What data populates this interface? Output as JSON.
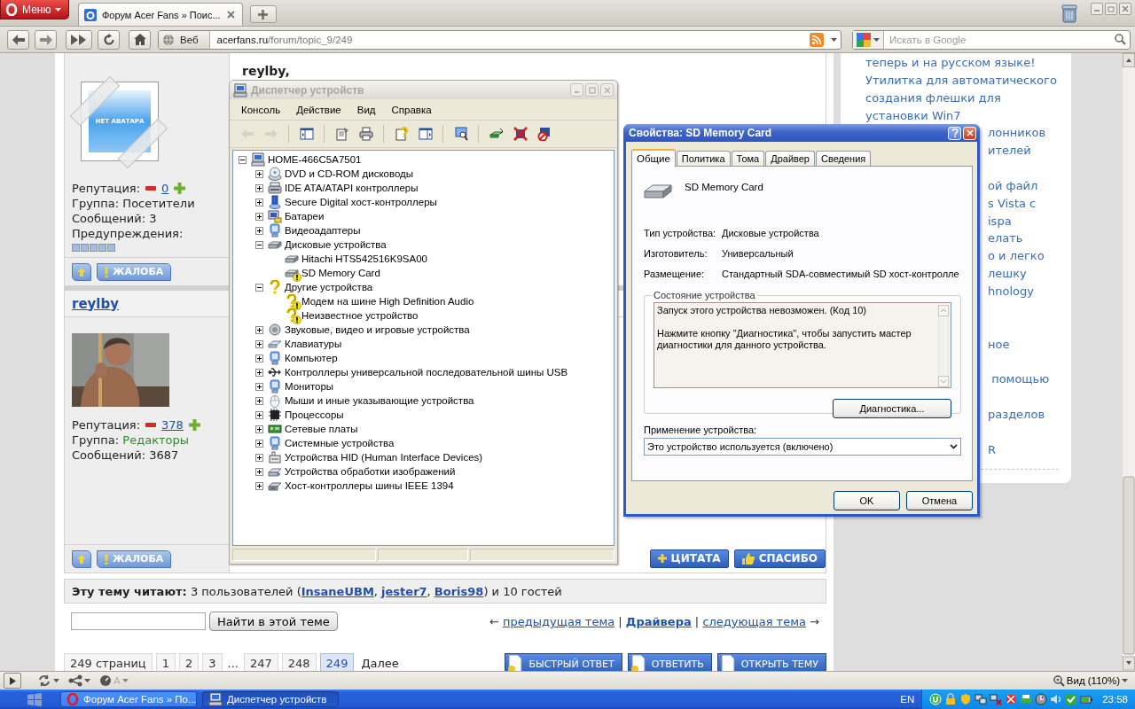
{
  "browser": {
    "menu_label": "Меню",
    "tabs": [
      {
        "title": "Форум Acer Fans » Поис...",
        "selected": true
      }
    ],
    "address": {
      "badge": "Веб",
      "host": "acerfans.ru",
      "path": "/forum/topic_9/249"
    },
    "search": {
      "placeholder": "Искать в Google"
    }
  },
  "forum": {
    "posts": [
      {
        "body": "reylby,",
        "avatar": {
          "kind": "placeholder",
          "caption": "НЕТ АВАТАРА"
        },
        "reputation": {
          "label": "Репутация:",
          "value": "0"
        },
        "group": {
          "label": "Группа:",
          "value": "Посетители",
          "color": "#222222"
        },
        "messages": "Сообщений: 3",
        "warnings": {
          "label": "Предупреждения:"
        },
        "actions": [
          "ЖАЛОБА"
        ]
      },
      {
        "author": "reylby",
        "avatar": {
          "kind": "picture"
        },
        "reputation": {
          "label": "Репутация:",
          "value": "378"
        },
        "group": {
          "label": "Группа:",
          "value": "Редакторы",
          "color": "#2e8b2e"
        },
        "messages": "Сообщений: 3687",
        "actions": [
          "ЖАЛОБА"
        ],
        "reply_actions": [
          "ЦИТАТА",
          "СПАСИБО"
        ]
      }
    ],
    "readers": [
      {
        "kind": "label",
        "text": "Эту тему читают:"
      },
      {
        "kind": "text",
        "text": " 3 пользователей ("
      },
      {
        "kind": "link",
        "text": "InsaneUBM"
      },
      {
        "kind": "text",
        "text": ", "
      },
      {
        "kind": "link",
        "text": "jester7"
      },
      {
        "kind": "text",
        "text": ", "
      },
      {
        "kind": "link",
        "text": "Boris98"
      },
      {
        "kind": "text",
        "text": ") и 10 гостей"
      }
    ],
    "topic_search": {
      "button": "Найти в этой теме"
    },
    "topic_nav": [
      {
        "kind": "text",
        "text": "← "
      },
      {
        "kind": "link",
        "text": "предыдущая тема"
      },
      {
        "kind": "text",
        "text": " | "
      },
      {
        "kind": "strong_link",
        "text": "Драйвера"
      },
      {
        "kind": "text",
        "text": " | "
      },
      {
        "kind": "link",
        "text": "следующая тема"
      },
      {
        "kind": "text",
        "text": " →"
      }
    ],
    "pages_label": "249 страниц",
    "pages": [
      {
        "kind": "page",
        "label": "1",
        "selected": false
      },
      {
        "kind": "page",
        "label": "2",
        "selected": false
      },
      {
        "kind": "page",
        "label": "3",
        "selected": false
      },
      {
        "kind": "gap",
        "label": "...",
        "selected": false
      },
      {
        "kind": "page",
        "label": "247",
        "selected": false
      },
      {
        "kind": "page",
        "label": "248",
        "selected": false
      },
      {
        "kind": "page",
        "label": "249",
        "selected": true
      }
    ],
    "next_label": "Далее",
    "topic_buttons": [
      "БЫСТРЫЙ ОТВЕТ",
      "ОТВЕТИТЬ",
      "ОТКРЫТЬ ТЕМУ"
    ]
  },
  "sidebar": {
    "lines": [
      {
        "text": "теперь и на русском языке!"
      },
      {
        "text": "Утилитка для автоматического"
      },
      {
        "text": "создания флешки для"
      },
      {
        "text": "установки Win7"
      },
      {
        "text": "лонников"
      },
      {
        "text": "ителей"
      },
      {
        "text": "ой файл"
      },
      {
        "text": "s Vista с"
      },
      {
        "text": "ispa"
      },
      {
        "text": "елать"
      },
      {
        "text": "о и легко"
      },
      {
        "text": "лешку"
      },
      {
        "text": "hnology"
      },
      {
        "text": "ное"
      },
      {
        "text": " помощью"
      },
      {
        "text": "разделов"
      },
      {
        "text": "R"
      }
    ]
  },
  "device_manager": {
    "title": "Диспетчер устройств",
    "menu": [
      "Консоль",
      "Действие",
      "Вид",
      "Справка"
    ],
    "toolbar": [
      {
        "kind": "back",
        "disabled": true
      },
      {
        "kind": "forward",
        "disabled": true
      },
      {
        "kind": "tree",
        "disabled": false
      },
      {
        "kind": "properties",
        "disabled": false
      },
      {
        "kind": "print",
        "disabled": false
      },
      {
        "kind": "help",
        "disabled": false
      },
      {
        "kind": "panel",
        "disabled": false
      },
      {
        "kind": "scan",
        "disabled": false
      },
      {
        "kind": "update",
        "disabled": false
      },
      {
        "kind": "uninstall",
        "disabled": false
      },
      {
        "kind": "disable",
        "disabled": false
      }
    ],
    "tree": [
      {
        "label": "HOME-466C5A7501",
        "kind": "computer",
        "expanded": true,
        "children": [
          {
            "label": "DVD и CD-ROM дисководы",
            "kind": "dvd",
            "expanded": false
          },
          {
            "label": "IDE ATA/ATAPI контроллеры",
            "kind": "ide",
            "expanded": false
          },
          {
            "label": "Secure Digital хост-контроллеры",
            "kind": "sd",
            "expanded": false
          },
          {
            "label": "Батареи",
            "kind": "battery",
            "expanded": false
          },
          {
            "label": "Видеоадаптеры",
            "kind": "monitor",
            "expanded": false
          },
          {
            "label": "Дисковые устройства",
            "kind": "disk",
            "expanded": true,
            "children": [
              {
                "label": "Hitachi HTS542516K9SA00",
                "kind": "disk",
                "problem": false
              },
              {
                "label": "SD Memory Card",
                "kind": "disk",
                "problem": true
              }
            ]
          },
          {
            "label": "Другие устройства",
            "kind": "other",
            "expanded": true,
            "children": [
              {
                "label": "Модем на шине High Definition Audio",
                "kind": "other",
                "problem": true
              },
              {
                "label": "Неизвестное устройство",
                "kind": "other",
                "problem": true
              }
            ]
          },
          {
            "label": "Звуковые, видео и игровые устройства",
            "kind": "sound",
            "expanded": false
          },
          {
            "label": "Клавиатуры",
            "kind": "keyboard",
            "expanded": false
          },
          {
            "label": "Компьютер",
            "kind": "monitor",
            "expanded": false
          },
          {
            "label": "Контроллеры универсальной последовательной шины USB",
            "kind": "usb",
            "expanded": false
          },
          {
            "label": "Мониторы",
            "kind": "monitor",
            "expanded": false
          },
          {
            "label": "Мыши и иные указывающие устройства",
            "kind": "mouse",
            "expanded": false
          },
          {
            "label": "Процессоры",
            "kind": "cpu",
            "expanded": false
          },
          {
            "label": "Сетевые платы",
            "kind": "network",
            "expanded": false
          },
          {
            "label": "Системные устройства",
            "kind": "monitor",
            "expanded": false
          },
          {
            "label": "Устройства HID (Human Interface Devices)",
            "kind": "hid",
            "expanded": false
          },
          {
            "label": "Устройства обработки изображений",
            "kind": "imaging",
            "expanded": false
          },
          {
            "label": "Хост-контроллеры шины IEEE 1394",
            "kind": "ieee",
            "expanded": false
          }
        ]
      }
    ]
  },
  "properties": {
    "title": "Свойства: SD Memory Card",
    "tabs": [
      {
        "label": "Общие",
        "selected": true
      },
      {
        "label": "Политика",
        "selected": false
      },
      {
        "label": "Тома",
        "selected": false
      },
      {
        "label": "Драйвер",
        "selected": false
      },
      {
        "label": "Сведения",
        "selected": false
      }
    ],
    "device_name": "SD Memory Card",
    "fields": [
      {
        "label": "Тип устройства:",
        "value": "Дисковые устройства"
      },
      {
        "label": "Изготовитель:",
        "value": "Универсальный"
      },
      {
        "label": "Размещение:",
        "value": "Стандартный SDA-совместимый SD хост-контролле"
      }
    ],
    "status": {
      "title": "Состояние устройства",
      "messages": [
        "Запуск этого устройства невозможен. (Код 10)",
        "Нажмите кнопку \"Диагностика\", чтобы запустить мастер диагностики для данного устройства."
      ],
      "button": "Диагностика..."
    },
    "usage": {
      "label": "Применение устройства:",
      "value": "Это устройство используется (включено)"
    },
    "buttons": [
      "OK",
      "Отмена"
    ]
  },
  "status_bar": {
    "glyph": "A",
    "zoom": "Вид (110%)"
  },
  "taskbar": {
    "tasks": [
      {
        "kind": "browser",
        "title": "Форум Acer Fans » По...",
        "selected": false
      },
      {
        "kind": "devices",
        "title": "Диспетчер устройств",
        "selected": true
      }
    ],
    "language": "EN",
    "clock": "23:58"
  }
}
